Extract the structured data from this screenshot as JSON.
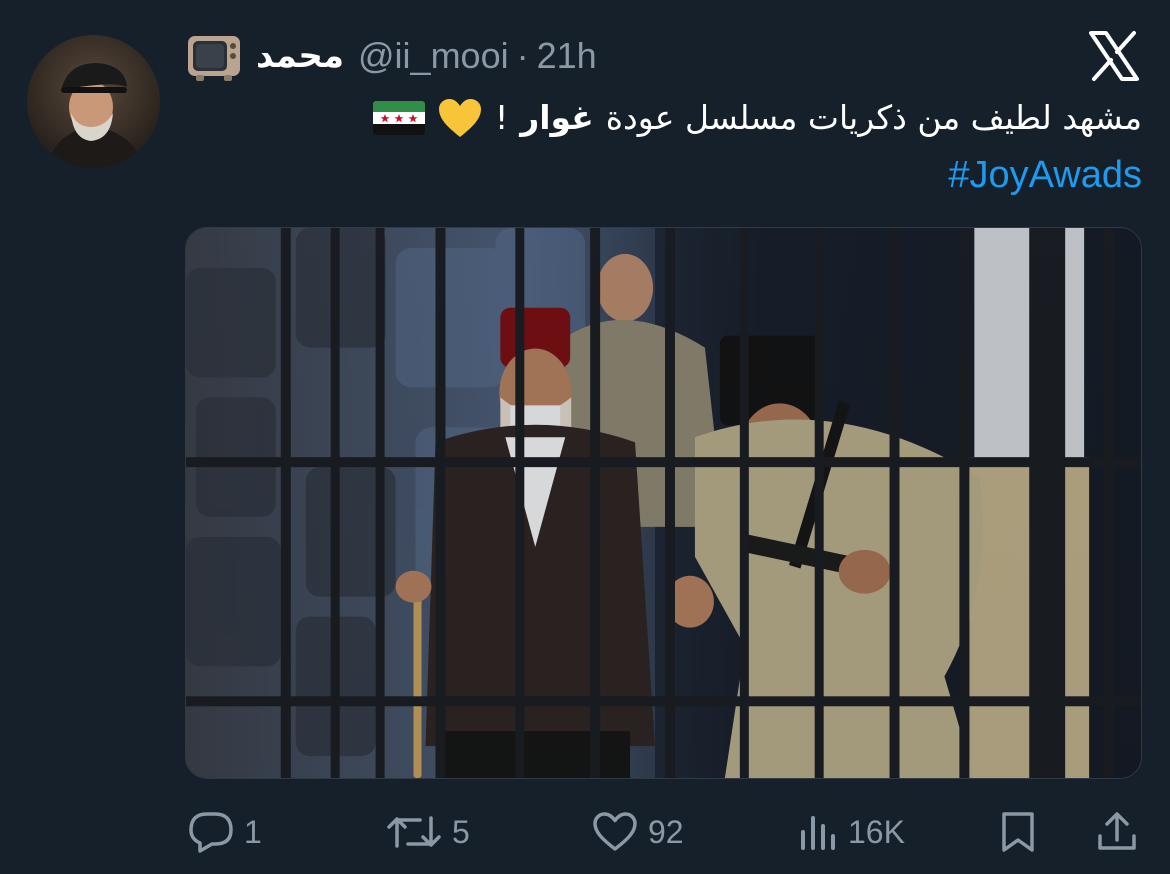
{
  "author": {
    "display_name": "محمد",
    "handle": "@ii_mooi",
    "separator": "·",
    "time": "21h",
    "name_emoji": "tv-icon"
  },
  "tweet": {
    "text_before": "مشهد لطيف من ذكريات مسلسل عودة",
    "text_bold": "غوار",
    "text_after": "!",
    "emojis": [
      "yellow-heart-icon",
      "syrian-revolution-flag-icon"
    ],
    "hashtag": "#JoyAwads"
  },
  "media": {
    "type": "image",
    "description_icon": "image-icon"
  },
  "actions": {
    "replies": "1",
    "reposts": "5",
    "likes": "92",
    "views": "16K"
  },
  "colors": {
    "background": "#15202b",
    "text": "#ffffff",
    "muted": "#8b98a5",
    "link": "#1d9bf0"
  }
}
